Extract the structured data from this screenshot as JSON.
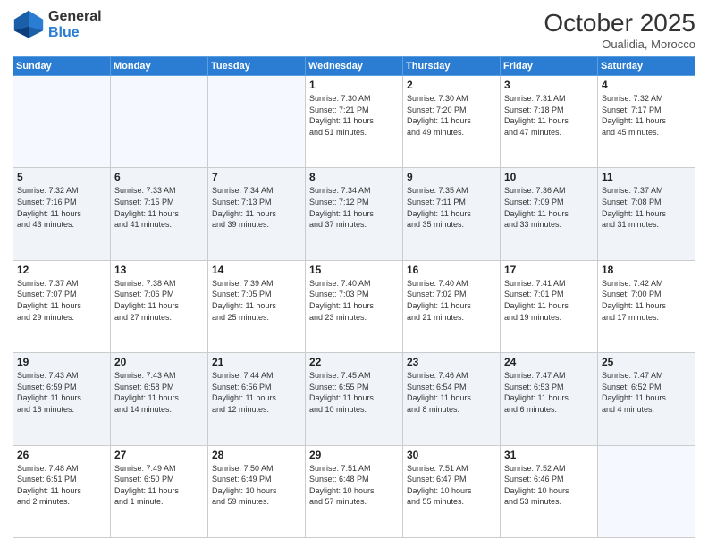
{
  "logo": {
    "general": "General",
    "blue": "Blue"
  },
  "title": "October 2025",
  "subtitle": "Oualidia, Morocco",
  "days_header": [
    "Sunday",
    "Monday",
    "Tuesday",
    "Wednesday",
    "Thursday",
    "Friday",
    "Saturday"
  ],
  "weeks": [
    [
      {
        "day": "",
        "info": ""
      },
      {
        "day": "",
        "info": ""
      },
      {
        "day": "",
        "info": ""
      },
      {
        "day": "1",
        "info": "Sunrise: 7:30 AM\nSunset: 7:21 PM\nDaylight: 11 hours\nand 51 minutes."
      },
      {
        "day": "2",
        "info": "Sunrise: 7:30 AM\nSunset: 7:20 PM\nDaylight: 11 hours\nand 49 minutes."
      },
      {
        "day": "3",
        "info": "Sunrise: 7:31 AM\nSunset: 7:18 PM\nDaylight: 11 hours\nand 47 minutes."
      },
      {
        "day": "4",
        "info": "Sunrise: 7:32 AM\nSunset: 7:17 PM\nDaylight: 11 hours\nand 45 minutes."
      }
    ],
    [
      {
        "day": "5",
        "info": "Sunrise: 7:32 AM\nSunset: 7:16 PM\nDaylight: 11 hours\nand 43 minutes."
      },
      {
        "day": "6",
        "info": "Sunrise: 7:33 AM\nSunset: 7:15 PM\nDaylight: 11 hours\nand 41 minutes."
      },
      {
        "day": "7",
        "info": "Sunrise: 7:34 AM\nSunset: 7:13 PM\nDaylight: 11 hours\nand 39 minutes."
      },
      {
        "day": "8",
        "info": "Sunrise: 7:34 AM\nSunset: 7:12 PM\nDaylight: 11 hours\nand 37 minutes."
      },
      {
        "day": "9",
        "info": "Sunrise: 7:35 AM\nSunset: 7:11 PM\nDaylight: 11 hours\nand 35 minutes."
      },
      {
        "day": "10",
        "info": "Sunrise: 7:36 AM\nSunset: 7:09 PM\nDaylight: 11 hours\nand 33 minutes."
      },
      {
        "day": "11",
        "info": "Sunrise: 7:37 AM\nSunset: 7:08 PM\nDaylight: 11 hours\nand 31 minutes."
      }
    ],
    [
      {
        "day": "12",
        "info": "Sunrise: 7:37 AM\nSunset: 7:07 PM\nDaylight: 11 hours\nand 29 minutes."
      },
      {
        "day": "13",
        "info": "Sunrise: 7:38 AM\nSunset: 7:06 PM\nDaylight: 11 hours\nand 27 minutes."
      },
      {
        "day": "14",
        "info": "Sunrise: 7:39 AM\nSunset: 7:05 PM\nDaylight: 11 hours\nand 25 minutes."
      },
      {
        "day": "15",
        "info": "Sunrise: 7:40 AM\nSunset: 7:03 PM\nDaylight: 11 hours\nand 23 minutes."
      },
      {
        "day": "16",
        "info": "Sunrise: 7:40 AM\nSunset: 7:02 PM\nDaylight: 11 hours\nand 21 minutes."
      },
      {
        "day": "17",
        "info": "Sunrise: 7:41 AM\nSunset: 7:01 PM\nDaylight: 11 hours\nand 19 minutes."
      },
      {
        "day": "18",
        "info": "Sunrise: 7:42 AM\nSunset: 7:00 PM\nDaylight: 11 hours\nand 17 minutes."
      }
    ],
    [
      {
        "day": "19",
        "info": "Sunrise: 7:43 AM\nSunset: 6:59 PM\nDaylight: 11 hours\nand 16 minutes."
      },
      {
        "day": "20",
        "info": "Sunrise: 7:43 AM\nSunset: 6:58 PM\nDaylight: 11 hours\nand 14 minutes."
      },
      {
        "day": "21",
        "info": "Sunrise: 7:44 AM\nSunset: 6:56 PM\nDaylight: 11 hours\nand 12 minutes."
      },
      {
        "day": "22",
        "info": "Sunrise: 7:45 AM\nSunset: 6:55 PM\nDaylight: 11 hours\nand 10 minutes."
      },
      {
        "day": "23",
        "info": "Sunrise: 7:46 AM\nSunset: 6:54 PM\nDaylight: 11 hours\nand 8 minutes."
      },
      {
        "day": "24",
        "info": "Sunrise: 7:47 AM\nSunset: 6:53 PM\nDaylight: 11 hours\nand 6 minutes."
      },
      {
        "day": "25",
        "info": "Sunrise: 7:47 AM\nSunset: 6:52 PM\nDaylight: 11 hours\nand 4 minutes."
      }
    ],
    [
      {
        "day": "26",
        "info": "Sunrise: 7:48 AM\nSunset: 6:51 PM\nDaylight: 11 hours\nand 2 minutes."
      },
      {
        "day": "27",
        "info": "Sunrise: 7:49 AM\nSunset: 6:50 PM\nDaylight: 11 hours\nand 1 minute."
      },
      {
        "day": "28",
        "info": "Sunrise: 7:50 AM\nSunset: 6:49 PM\nDaylight: 10 hours\nand 59 minutes."
      },
      {
        "day": "29",
        "info": "Sunrise: 7:51 AM\nSunset: 6:48 PM\nDaylight: 10 hours\nand 57 minutes."
      },
      {
        "day": "30",
        "info": "Sunrise: 7:51 AM\nSunset: 6:47 PM\nDaylight: 10 hours\nand 55 minutes."
      },
      {
        "day": "31",
        "info": "Sunrise: 7:52 AM\nSunset: 6:46 PM\nDaylight: 10 hours\nand 53 minutes."
      },
      {
        "day": "",
        "info": ""
      }
    ]
  ]
}
